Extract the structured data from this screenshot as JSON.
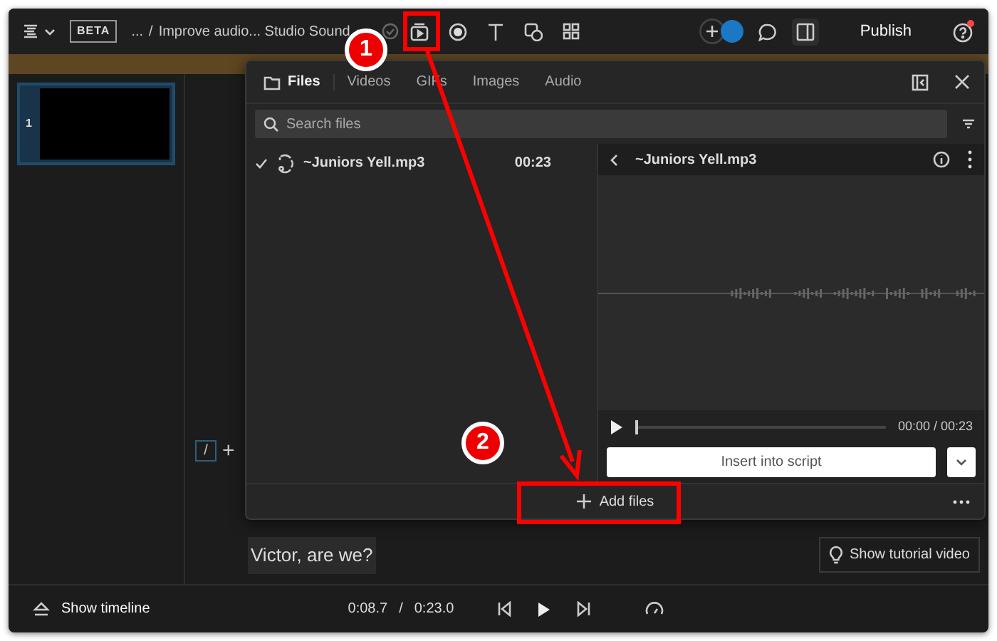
{
  "toolbar": {
    "badge": "BETA",
    "breadcrumb_prefix": "...",
    "separator": "/",
    "project_title": "Improve audio... Studio Sound",
    "publish": "Publish"
  },
  "slides": [
    {
      "number": "1",
      "selected": true
    }
  ],
  "media_panel": {
    "tabs": [
      {
        "label": "Files",
        "selected": true
      },
      {
        "label": "Videos",
        "selected": false
      },
      {
        "label": "GIFs",
        "selected": false
      },
      {
        "label": "Images",
        "selected": false
      },
      {
        "label": "Audio",
        "selected": false
      }
    ],
    "search": {
      "placeholder": "Search files"
    },
    "files": [
      {
        "name": "~Juniors Yell.mp3",
        "duration": "00:23",
        "checked": true
      }
    ],
    "preview": {
      "title": "~Juniors Yell.mp3",
      "time": "00:00 / 00:23",
      "level": 0
    },
    "insert_button": "Insert into script",
    "add_files": "Add files"
  },
  "editor": {
    "slash": "/",
    "add": "+",
    "text": "Victor, are we?",
    "tutorial": "Show tutorial video"
  },
  "bottom_bar": {
    "timeline": "Show timeline",
    "current_time": "0:08.7",
    "separator": "/",
    "total_time": "0:23.0"
  },
  "annotations": [
    {
      "label": "1"
    },
    {
      "label": "2"
    }
  ]
}
